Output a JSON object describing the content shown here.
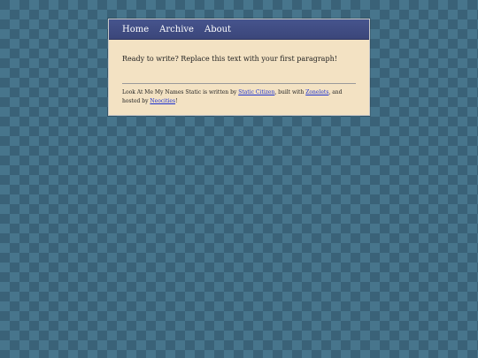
{
  "nav": {
    "items": [
      "Home",
      "Archive",
      "About"
    ]
  },
  "main": {
    "paragraph": "Ready to write? Replace this text with your first paragraph!"
  },
  "footer": {
    "text_1": "Look At Me My Names Static is written by ",
    "link_author": "Static Citizen",
    "text_2": ", built with ",
    "link_builder": "Zonelets",
    "text_3": ", and hosted by ",
    "link_host": "Neocities",
    "text_4": "!"
  },
  "colors": {
    "background": "#3a6278",
    "pattern": "#47758c",
    "page": "#f3e2c3",
    "nav": "#3f4b80",
    "link": "#1a2fcf"
  }
}
